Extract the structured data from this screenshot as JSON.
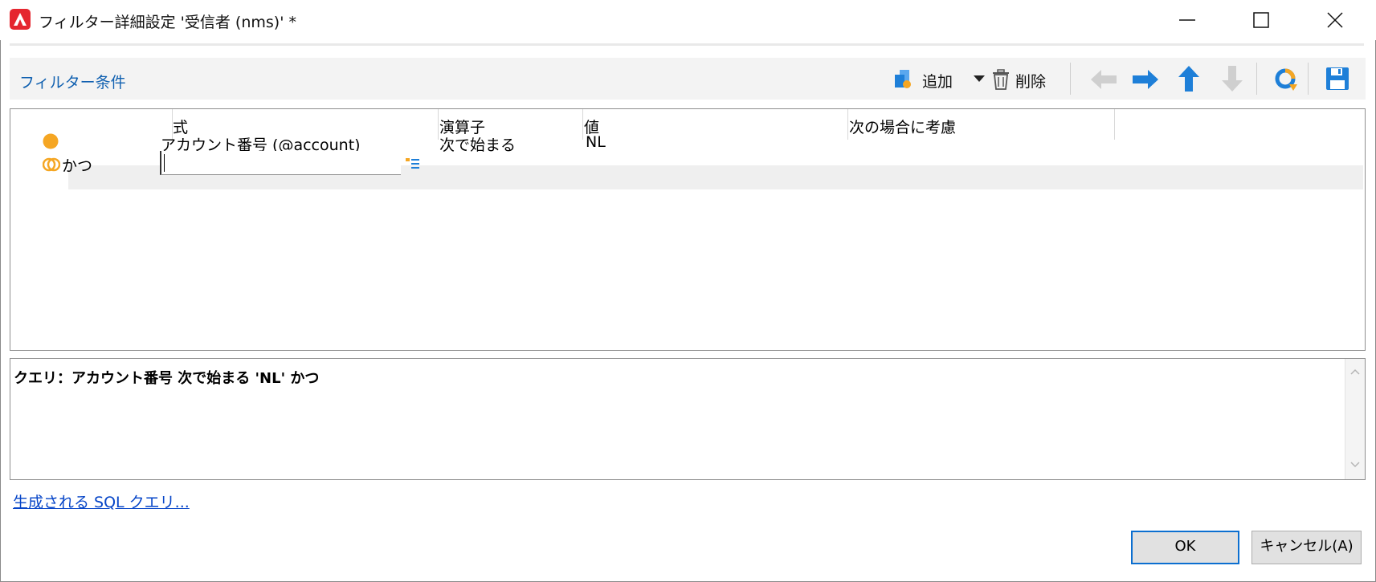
{
  "window": {
    "title": "フィルター詳細設定 '受信者 (nms)' *",
    "controls": [
      "minimize-icon",
      "maximize-icon",
      "close-icon"
    ]
  },
  "toolbar": {
    "section_label": "フィルター条件",
    "add_label": "追加",
    "delete_label": "削除",
    "icons": [
      "add-condition-icon",
      "dropdown-arrow-icon",
      "trash-icon",
      "arrow-left-icon",
      "arrow-right-icon",
      "arrow-up-icon",
      "arrow-down-icon",
      "distribution-icon",
      "save-icon"
    ]
  },
  "grid": {
    "columns": [
      "式",
      "演算子",
      "値",
      "次の場合に考慮"
    ],
    "rows": [
      {
        "expression": "アカウント番号 (@account)",
        "operator": "次で始まる",
        "value": "NL"
      },
      {
        "label": "かつ",
        "expression_value": ""
      }
    ]
  },
  "query": {
    "text": "クエリ：アカウント番号 次で始まる 'NL' かつ"
  },
  "sql_link": "生成される SQL クエリ...",
  "buttons": {
    "ok": "OK",
    "cancel": "キャンセル(A)"
  },
  "colors": {
    "accent": "#1060b0",
    "brand_red": "#e5262f",
    "condition_orange": "#f5a623",
    "arrow_blue": "#1e7fd8"
  }
}
